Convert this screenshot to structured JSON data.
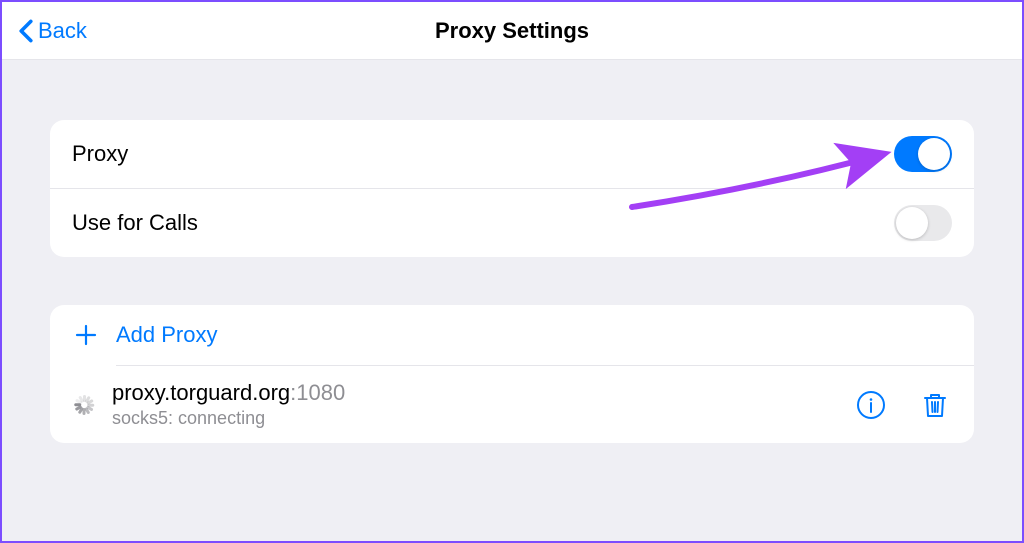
{
  "header": {
    "back_label": "Back",
    "title": "Proxy Settings"
  },
  "settings": {
    "proxy_label": "Proxy",
    "proxy_enabled": true,
    "use_for_calls_label": "Use for Calls",
    "use_for_calls_enabled": false
  },
  "proxies": {
    "add_label": "Add Proxy",
    "list": [
      {
        "host": "proxy.torguard.org",
        "port": "1080",
        "status": "socks5: connecting"
      }
    ]
  }
}
